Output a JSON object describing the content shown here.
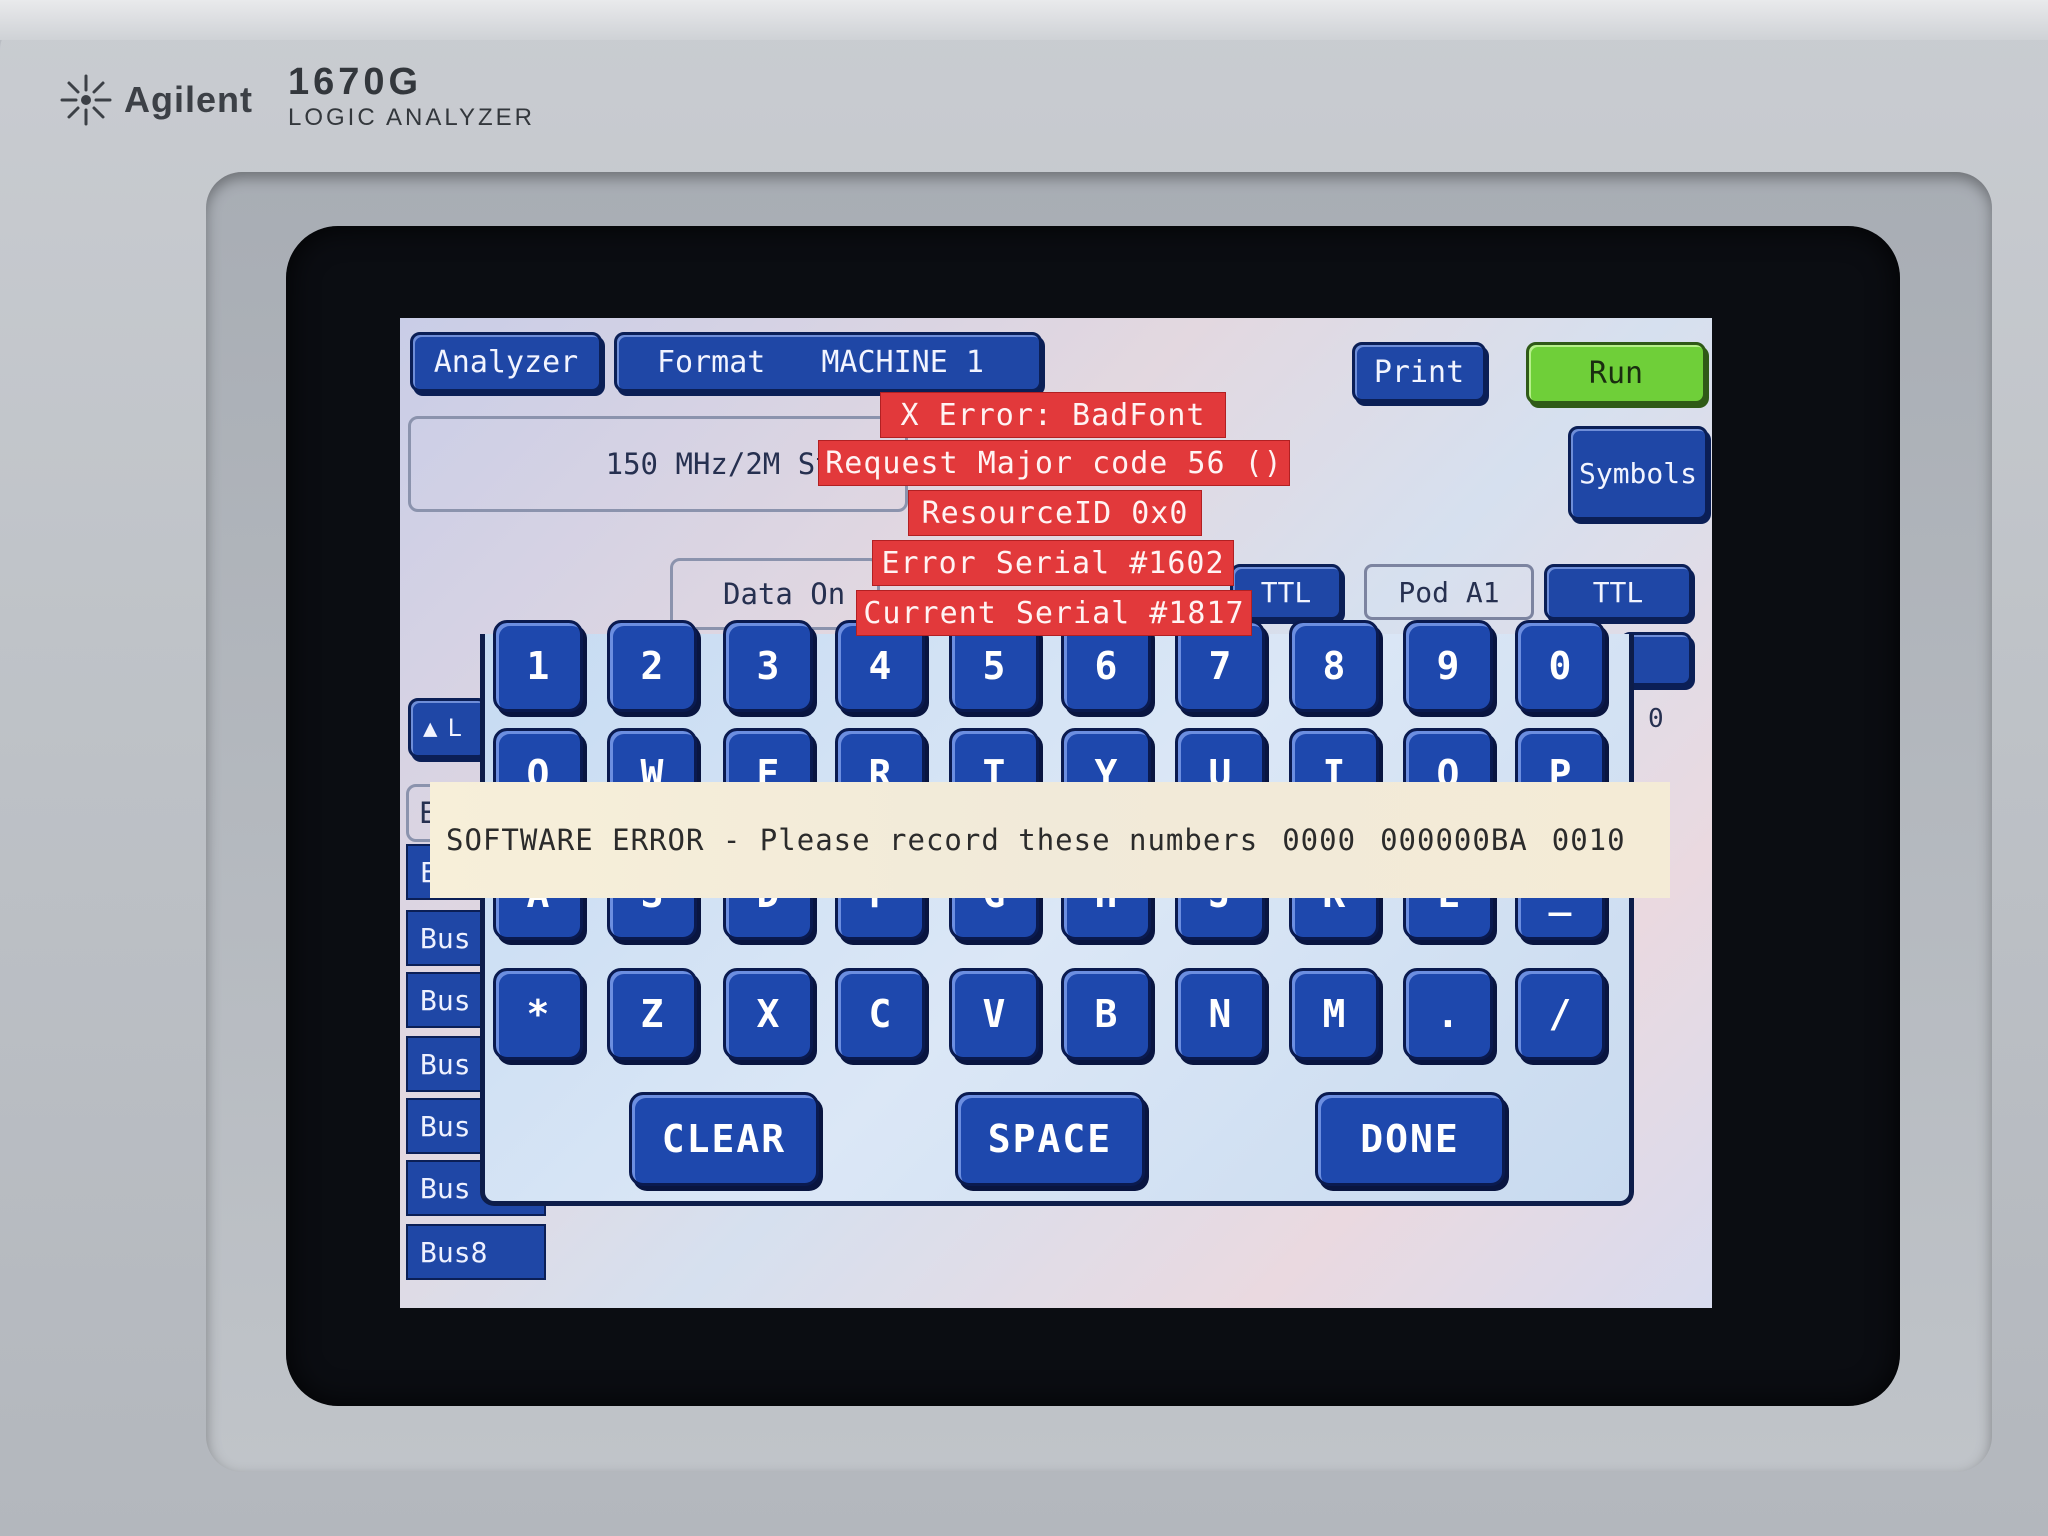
{
  "bezel": {
    "brand": "Agilent",
    "model_number": "1670G",
    "model_type": "LOGIC ANALYZER"
  },
  "top_bar": {
    "analyzer_label": "Analyzer",
    "format_label": "Format",
    "machine_label": "MACHINE 1",
    "print_label": "Print",
    "run_label": "Run",
    "symbols_label": "Symbols"
  },
  "state_panel": {
    "mode_text": "150 MHz/2M State"
  },
  "pods": {
    "data_on_label": "Data On",
    "ttl_left_label": "TTL",
    "pod_label": "Pod A1",
    "ttl_right_label": "TTL",
    "scale_digit": "0"
  },
  "left_column": {
    "up_arrow_label": "L",
    "partial_rows": [
      "E",
      "E"
    ],
    "bus_items": [
      "Bus",
      "Bus",
      "Bus",
      "Bus",
      "Bus",
      "Bus8"
    ]
  },
  "keyboard": {
    "row1": [
      "1",
      "2",
      "3",
      "4",
      "5",
      "6",
      "7",
      "8",
      "9",
      "0"
    ],
    "row2": [
      "Q",
      "W",
      "E",
      "R",
      "T",
      "Y",
      "U",
      "I",
      "O",
      "P"
    ],
    "row3": [
      "A",
      "S",
      "D",
      "F",
      "G",
      "H",
      "J",
      "K",
      "L",
      "_"
    ],
    "row4": [
      "*",
      "Z",
      "X",
      "C",
      "V",
      "B",
      "N",
      "M",
      ".",
      "/"
    ],
    "clear_label": "CLEAR",
    "space_label": "SPACE",
    "done_label": "DONE"
  },
  "x_error": {
    "title": "X Error:  BadFont",
    "request": "Request Major code 56 ()",
    "resource": "ResourceID 0x0",
    "error_serial": "Error Serial #1602",
    "current_serial": "Current Serial #1817"
  },
  "software_error": {
    "message": "SOFTWARE ERROR - Please record these numbers",
    "num1": "0000",
    "num2": "000000BA",
    "num3": "0010"
  },
  "colors": {
    "button_blue": "#1f47a6",
    "run_green": "#6fcf39",
    "error_red": "#e2393b",
    "warning_bg": "#f4ebd6"
  }
}
